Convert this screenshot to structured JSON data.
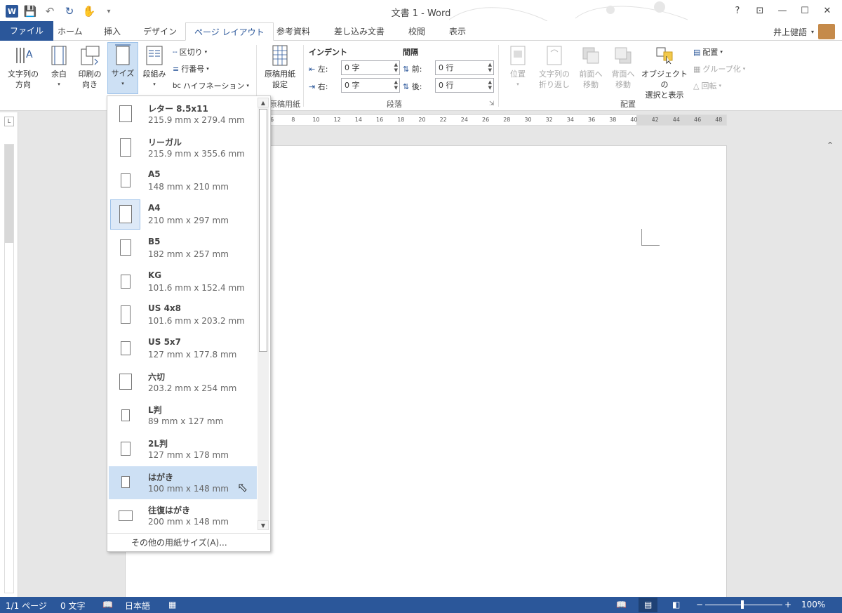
{
  "window": {
    "title": "文書 1 - Word",
    "controls": [
      "?",
      "⊡",
      "—",
      "☐",
      "✕"
    ]
  },
  "tabs": {
    "file": "ファイル",
    "items": [
      "ホーム",
      "挿入",
      "デザイン",
      "ページ レイアウト",
      "参考資料",
      "差し込み文書",
      "校閲",
      "表示"
    ],
    "active": "ページ レイアウト"
  },
  "user": {
    "name": "井上健語"
  },
  "ribbon": {
    "page_setup": {
      "text_direction": "文字列の\n方向",
      "margins": "余白",
      "orientation": "印刷の\n向き",
      "size": "サイズ",
      "columns": "段組み",
      "breaks": "区切り",
      "line_numbers": "行番号",
      "hyphenation": "ハイフネーション"
    },
    "genko": {
      "button": "原稿用紙\n設定",
      "group_label": "原稿用紙"
    },
    "paragraph": {
      "indent_label": "インデント",
      "spacing_label": "間隔",
      "left_label": "左:",
      "right_label": "右:",
      "before_label": "前:",
      "after_label": "後:",
      "left_value": "0 字",
      "right_value": "0 字",
      "before_value": "0 行",
      "after_value": "0 行",
      "group_label": "段落"
    },
    "arrange": {
      "position": "位置",
      "wrap_text": "文字列の\n折り返し",
      "bring_forward": "前面へ\n移動",
      "send_backward": "背面へ\n移動",
      "selection_pane": "オブジェクトの\n選択と表示",
      "align": "配置",
      "group": "グループ化",
      "rotate": "回転",
      "group_label": "配置"
    }
  },
  "ruler": {
    "marks": [
      "6",
      "8",
      "10",
      "12",
      "14",
      "16",
      "18",
      "20",
      "22",
      "24",
      "26",
      "28",
      "30",
      "32",
      "34",
      "36",
      "38",
      "40",
      "42",
      "44",
      "46",
      "48"
    ]
  },
  "size_menu": {
    "items": [
      {
        "name": "レター 8.5x11",
        "size": "215.9 mm x 279.4 mm"
      },
      {
        "name": "リーガル",
        "size": "215.9 mm x 355.6 mm"
      },
      {
        "name": "A5",
        "size": "148 mm x 210 mm"
      },
      {
        "name": "A4",
        "size": "210 mm x 297 mm"
      },
      {
        "name": "B5",
        "size": "182 mm x 257 mm"
      },
      {
        "name": "KG",
        "size": "101.6 mm x 152.4 mm"
      },
      {
        "name": "US 4x8",
        "size": "101.6 mm x 203.2 mm"
      },
      {
        "name": "US 5x7",
        "size": "127 mm x 177.8 mm"
      },
      {
        "name": "六切",
        "size": "203.2 mm x 254 mm"
      },
      {
        "name": "L判",
        "size": "89 mm x 127 mm"
      },
      {
        "name": "2L判",
        "size": "127 mm x 178 mm"
      },
      {
        "name": "はがき",
        "size": "100 mm x 148 mm"
      },
      {
        "name": "往復はがき",
        "size": "200 mm x 148 mm"
      }
    ],
    "selected": "A4",
    "hovered": "はがき",
    "footer": "その他の用紙サイズ(A)..."
  },
  "status": {
    "page": "1/1 ページ",
    "words": "0 文字",
    "language": "日本語",
    "zoom": "100%",
    "zoom_minus": "−",
    "zoom_plus": "+"
  }
}
